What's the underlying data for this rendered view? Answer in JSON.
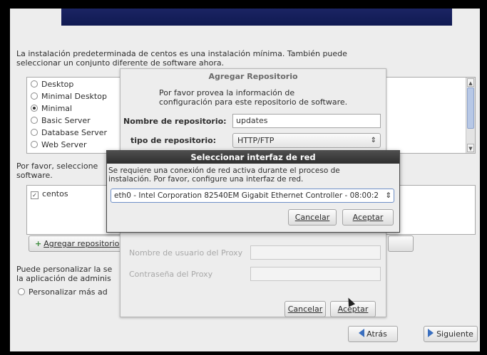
{
  "intro": {
    "line1": "La instalación predeterminada de centos es una instalación mínima. También puede",
    "line2": "seleccionar un conjunto diferente de software ahora."
  },
  "environments": [
    {
      "label": "Desktop",
      "selected": false
    },
    {
      "label": "Minimal Desktop",
      "selected": false
    },
    {
      "label": "Minimal",
      "selected": true
    },
    {
      "label": "Basic Server",
      "selected": false
    },
    {
      "label": "Database Server",
      "selected": false
    },
    {
      "label": "Web Server",
      "selected": false
    }
  ],
  "repos_section": {
    "label_line1": "Por favor, seleccione",
    "label_line2": "software."
  },
  "repos": [
    {
      "label": "centos",
      "checked": true
    }
  ],
  "add_repo_button": "Agregar repositorio",
  "customize": {
    "line1": "Puede personalizar la se",
    "line2": "la aplicación de adminis",
    "option": "Personalizar más ad"
  },
  "nav": {
    "back": "Atrás",
    "next": "Siguiente"
  },
  "repo_dialog": {
    "title": "Agregar Repositorio",
    "desc_line1": "Por favor provea la información de",
    "desc_line2": "configuración para este repositorio de software.",
    "name_label": "Nombre de repositorio:",
    "name_value": "updates",
    "type_label": "tipo de repositorio:",
    "type_value": "HTTP/FTP",
    "proxy_user_label": "Nombre de usuario del Proxy",
    "proxy_pass_label": "Contraseña del Proxy",
    "cancel": "Cancelar",
    "accept": "Aceptar"
  },
  "net_dialog": {
    "title": "Seleccionar interfaz de red",
    "msg_line1": "Se requiere una conexión de red activa durante el proceso de",
    "msg_line2": "instalación. Por favor, configure una interfaz de red.",
    "interface": "eth0 - Intel Corporation 82540EM Gigabit Ethernet Controller - 08:00:2",
    "cancel": "Cancelar",
    "accept": "Aceptar"
  },
  "colors": {
    "banner": "#1b2463",
    "dialog_title_bar": "#3a3a3a",
    "arrow_blue": "#3a6fbf"
  },
  "icons": {
    "radio": "radio-button",
    "check": "checkbox",
    "spin": "combo-arrows-icon",
    "add": "plus-icon",
    "back": "arrow-left-icon",
    "next": "arrow-right-icon"
  }
}
